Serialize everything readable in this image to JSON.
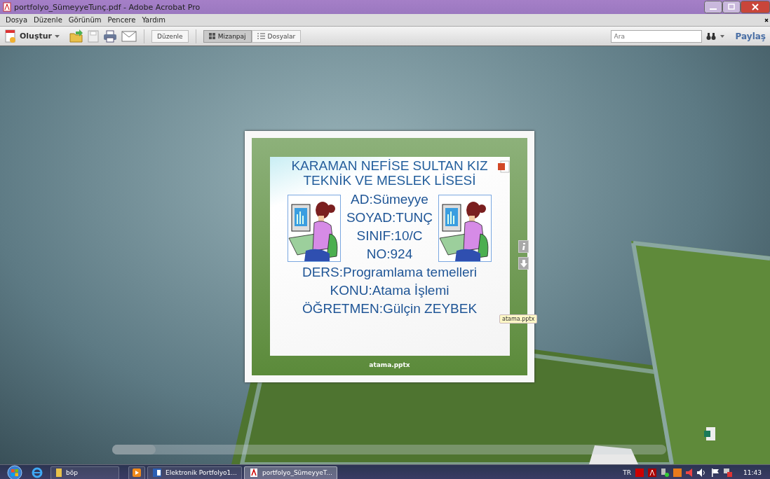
{
  "window": {
    "title": "portfolyo_SümeyyeTunç.pdf - Adobe Acrobat Pro"
  },
  "menu": [
    "Dosya",
    "Düzenle",
    "Görünüm",
    "Pencere",
    "Yardım"
  ],
  "toolbar": {
    "create": "Oluştur",
    "edit": "Düzenle",
    "views": [
      {
        "label": "Mizanpaj",
        "selected": true
      },
      {
        "label": "Dosyalar",
        "selected": false
      }
    ],
    "search": {
      "placeholder": "Ara"
    },
    "share": "Paylaş"
  },
  "viewer": {
    "caption": "atama.pptx",
    "tooltip": "atama.pptx",
    "slide": {
      "title": [
        "KARAMAN NEFİSE SULTAN KIZ",
        "TEKNİK VE MESLEK LİSESİ"
      ],
      "side_lines": [
        "AD:Sümeyye",
        "SOYAD:TUNÇ",
        "SINIF:10/C",
        "NO:924"
      ],
      "lines": [
        "DERS:Programlama temelleri",
        "KONU:Atama İşlemi",
        "ÖĞRETMEN:Gülçin ZEYBEK"
      ]
    }
  },
  "taskbar": {
    "items": [
      {
        "kind": "folder",
        "label": "böp",
        "selected": false
      },
      {
        "kind": "media",
        "selected": false
      },
      {
        "kind": "word",
        "label": "Elektronik Portfolyo1...",
        "selected": false
      },
      {
        "kind": "pdf",
        "label": "portfolyo_SümeyyeT...",
        "selected": true
      }
    ],
    "language": "TR",
    "clock": "11:43"
  }
}
